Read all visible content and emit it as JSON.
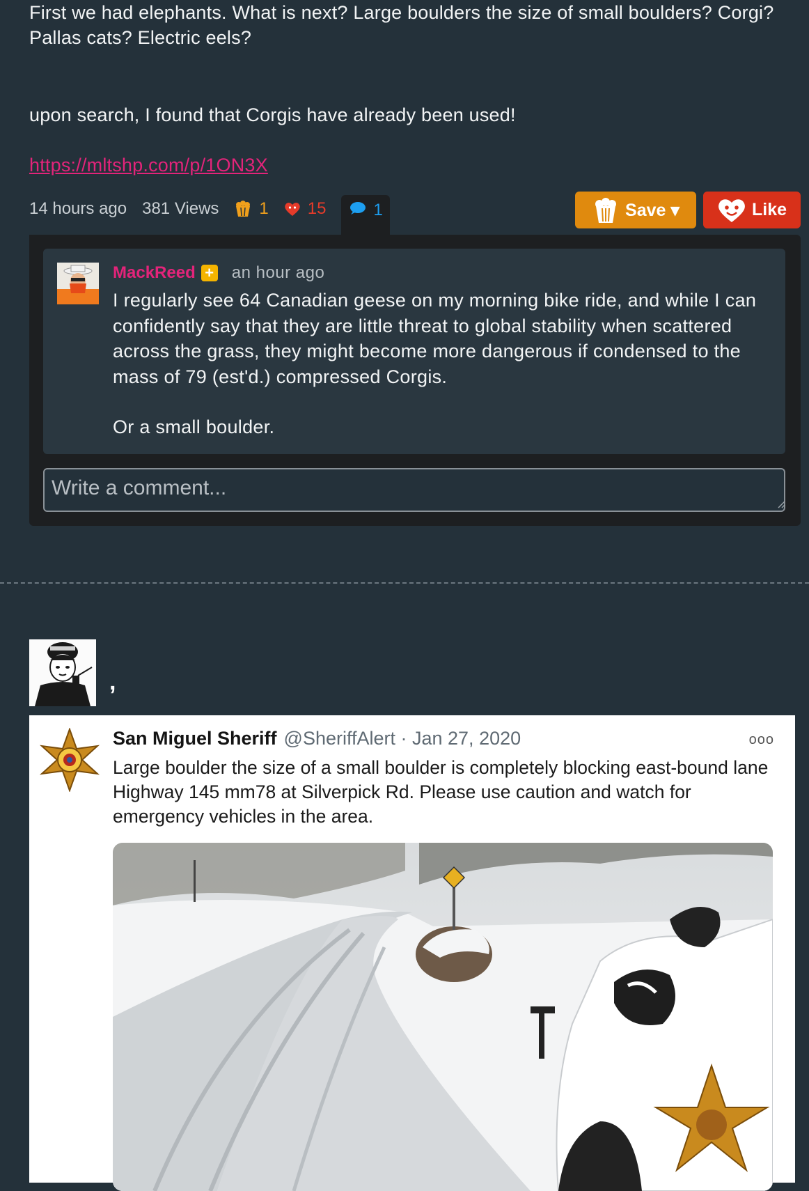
{
  "post": {
    "paragraph1": "First we had elephants. What is next? Large boulders the size of small boulders? Corgi? Pallas cats? Electric eels?",
    "paragraph2": "upon search, I found that Corgis have already been used!",
    "link": "https://mltshp.com/p/1ON3X"
  },
  "meta": {
    "time": "14 hours ago",
    "views": "381 Views",
    "saves": "1",
    "likes": "15",
    "comments": "1"
  },
  "buttons": {
    "save": "Save ▾",
    "like": "Like"
  },
  "comment": {
    "author": "MackReed",
    "badge": "+",
    "time": "an hour ago",
    "body1": "I regularly see 64 Canadian geese on my morning bike ride, and while I can confidently say that they are little threat to global stability when scattered across the grass, they might become more dangerous if condensed to the mass of 79 (est'd.) compressed Corgis.",
    "body2": "Or a small boulder."
  },
  "comment_input": {
    "placeholder": "Write a comment..."
  },
  "next_post": {
    "title": ","
  },
  "tweet": {
    "name": "San Miguel Sheriff",
    "handle": "@SheriffAlert · Jan 27, 2020",
    "more": "ooo",
    "text": "Large boulder the size of a small boulder is completely blocking east-bound lane Highway 145 mm78 at Silverpick Rd. Please use caution and watch for emergency vehicles in the area."
  },
  "colors": {
    "background": "#24313a",
    "link": "#e3247a",
    "save": "#e08a0e",
    "like": "#d8311a",
    "comment_accent": "#1d9ff1"
  }
}
